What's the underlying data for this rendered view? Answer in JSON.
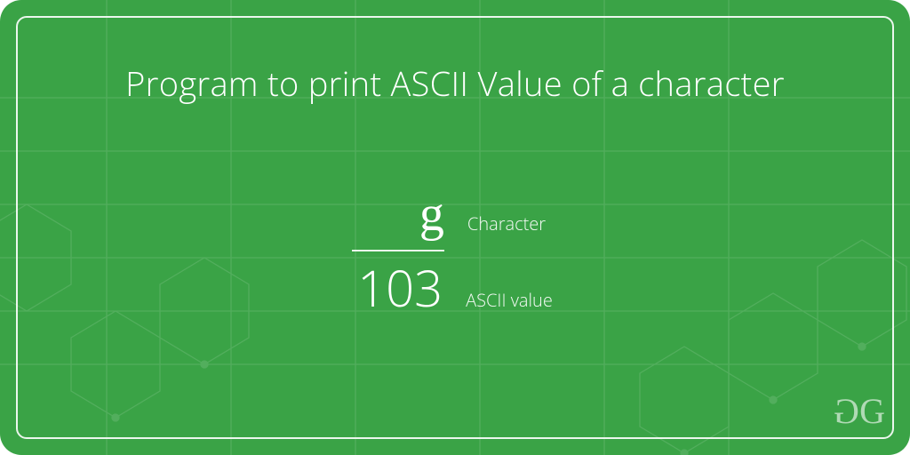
{
  "title": "Program to print ASCII Value of a character",
  "example": {
    "character": "g",
    "character_label": "Character",
    "ascii_value": "103",
    "ascii_label": "ASCII value"
  },
  "brand": {
    "glyph1": "G",
    "glyph2": "G"
  },
  "colors": {
    "background": "#3aa346",
    "text": "#ffffff"
  }
}
